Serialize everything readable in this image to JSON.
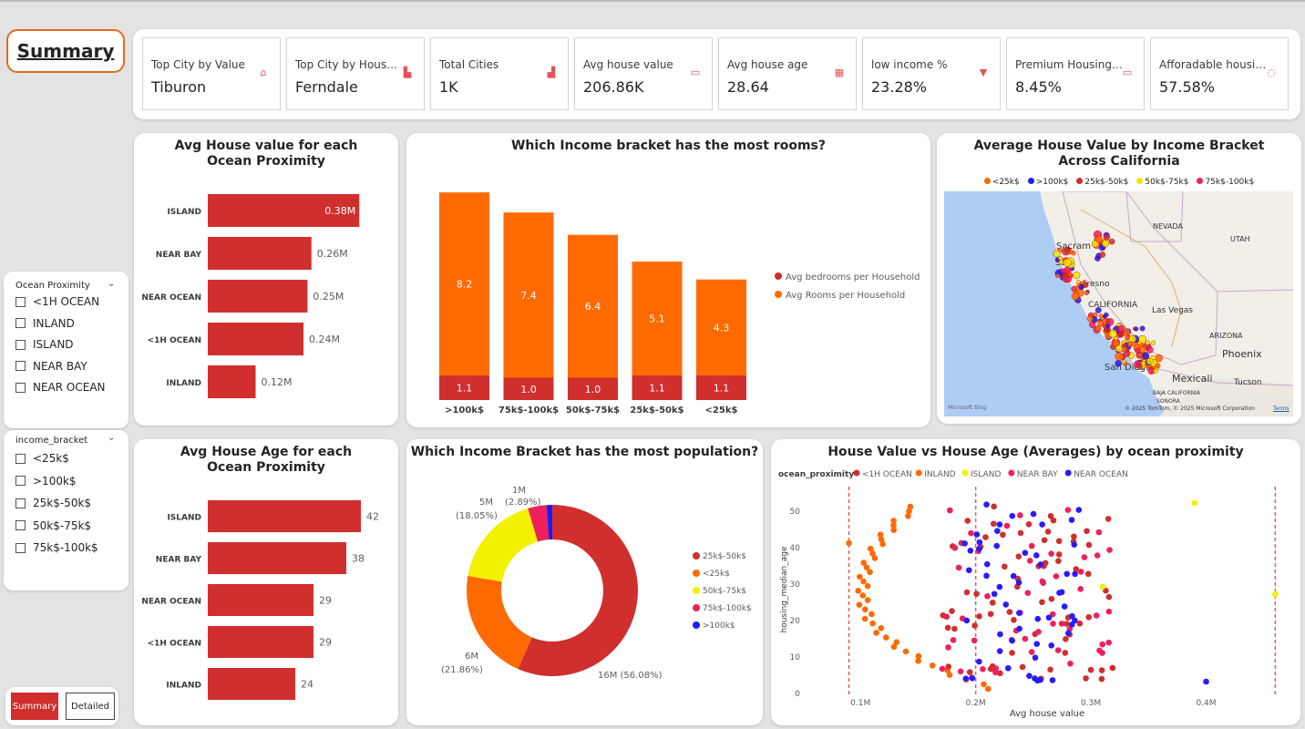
{
  "page_title": "Summary",
  "kpis": [
    {
      "label": "Top City by Value",
      "value": "Tiburon",
      "icon": "house-icon"
    },
    {
      "label": "Top City by House...",
      "value": "Ferndale",
      "icon": "building-icon"
    },
    {
      "label": "Total Cities",
      "value": "1K",
      "icon": "city-icon"
    },
    {
      "label": "Avg house value",
      "value": "206.86K",
      "icon": "money-icon"
    },
    {
      "label": "Avg house age",
      "value": "28.64",
      "icon": "calendar-icon"
    },
    {
      "label": "low income %",
      "value": "23.28%",
      "icon": "arrow-down-icon"
    },
    {
      "label": "Premium Housing %",
      "value": "8.45%",
      "icon": "cash-icon"
    },
    {
      "label": "Afforadable housing...",
      "value": "57.58%",
      "icon": "tag-icon"
    }
  ],
  "slicers": {
    "ocean": {
      "title": "Ocean Proximity",
      "options": [
        "<1H OCEAN",
        "INLAND",
        "ISLAND",
        "NEAR BAY",
        "NEAR OCEAN"
      ]
    },
    "income": {
      "title": "income_bracket",
      "options": [
        "<25k$",
        ">100k$",
        "25k$-50k$",
        "50k$-75k$",
        "75k$-100k$"
      ]
    }
  },
  "nav": {
    "summary": "Summary",
    "detailed": "Detailed"
  },
  "visuals": {
    "house_value_title": "Avg House value for each Ocean Proximity",
    "rooms_title": "Which Income bracket has the most rooms?",
    "map_title": "Average House Value by Income Bracket Across California",
    "age_title": "Avg House Age for each Ocean Proximity",
    "population_title": "Which Income Bracket has the most population?",
    "scatter_title": "House Value vs House Age (Averages) by ocean proximity"
  },
  "map": {
    "legend": [
      "<25k$",
      ">100k$",
      "25k$-50k$",
      "50k$-75k$",
      "75k$-100k$"
    ],
    "legend_colors": [
      "#ff6a00",
      "#1a1aff",
      "#d12e2e",
      "#f2e600",
      "#f0205c"
    ],
    "labels": [
      "NEVADA",
      "UTAH",
      "Sacram",
      "San",
      "Fresno",
      "CALIFORNIA",
      "Las Vegas",
      "ARIZONA",
      "Phoenix",
      "San Diego",
      "Mexicali",
      "Tucson",
      "BAJA CALIFORNIA",
      "SONORA"
    ],
    "attribution": "© 2025 TomTom, © 2025 Microsoft Corporation",
    "terms": "Terms",
    "bing": "Microsoft Bing"
  },
  "chart_data": [
    {
      "type": "bar",
      "orientation": "horizontal",
      "title": "Avg House value for each Ocean Proximity",
      "categories": [
        "ISLAND",
        "NEAR BAY",
        "NEAR OCEAN",
        "<1H OCEAN",
        "INLAND"
      ],
      "values": [
        0.38,
        0.26,
        0.25,
        0.24,
        0.12
      ],
      "labels": [
        "0.38M",
        "0.26M",
        "0.25M",
        "0.24M",
        "0.12M"
      ],
      "color": "#d12e2e"
    },
    {
      "type": "bar",
      "stacked": true,
      "title": "Which Income bracket has the most rooms?",
      "categories": [
        ">100k$",
        "75k$-100k$",
        "50k$-75k$",
        "25k$-50k$",
        "<25k$"
      ],
      "series": [
        {
          "name": "Avg bedrooms per Household",
          "values": [
            1.1,
            1.0,
            1.0,
            1.1,
            1.1
          ],
          "color": "#d12e2e"
        },
        {
          "name": "Avg Rooms per Household",
          "values": [
            8.2,
            7.4,
            6.4,
            5.1,
            4.3
          ],
          "color": "#ff6a00"
        }
      ],
      "legend": "right"
    },
    {
      "type": "bar",
      "orientation": "horizontal",
      "title": "Avg House Age for each Ocean Proximity",
      "categories": [
        "ISLAND",
        "NEAR BAY",
        "NEAR OCEAN",
        "<1H OCEAN",
        "INLAND"
      ],
      "values": [
        42,
        38,
        29,
        29,
        24
      ],
      "color": "#d12e2e"
    },
    {
      "type": "pie",
      "donut": true,
      "title": "Which Income Bracket has the most population?",
      "categories": [
        "25k$-50k$",
        "<25k$",
        "50k$-75k$",
        "75k$-100k$",
        ">100k$"
      ],
      "values": [
        16,
        6,
        5,
        1,
        0.3
      ],
      "labels": [
        "16M (56.08%)",
        "6M (21.86%)",
        "5M (18.05%)",
        "1M (2.89%)",
        ""
      ],
      "colors": [
        "#d12e2e",
        "#ff6a00",
        "#f2f200",
        "#f0205c",
        "#1a1aff"
      ],
      "legend": "right"
    },
    {
      "type": "scatter",
      "title": "House Value vs House Age (Averages) by ocean proximity",
      "xlabel": "Avg house value",
      "ylabel": "housing_median_age",
      "legend_title": "ocean_proximity",
      "series_names": [
        "<1H OCEAN",
        "INLAND",
        "ISLAND",
        "NEAR BAY",
        "NEAR OCEAN"
      ],
      "colors": [
        "#d12e2e",
        "#ff6a00",
        "#f2f200",
        "#f0205c",
        "#2a1aff"
      ],
      "x_ticks": [
        "0.1M",
        "0.2M",
        "0.3M",
        "0.4M"
      ],
      "y_ticks": [
        "0",
        "10",
        "20",
        "30",
        "40",
        "50"
      ],
      "xlim": [
        0.05,
        0.47
      ],
      "ylim": [
        0,
        53
      ]
    }
  ]
}
